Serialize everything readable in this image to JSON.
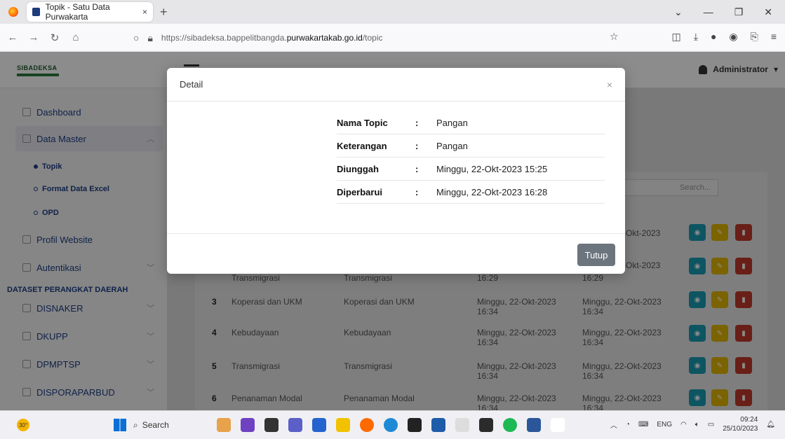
{
  "browser": {
    "tab_title": "Topik - Satu Data Purwakarta",
    "tab_close": "×",
    "new_tab": "+",
    "url_prefix": "https://sibadeksa.bappelitbangda.",
    "url_host": "purwakartakab.go.id",
    "url_path": "/topic"
  },
  "app": {
    "logo": "SIBADEKSA",
    "user": "Administrator"
  },
  "sidebar": {
    "dashboard": "Dashboard",
    "data_master": "Data Master",
    "topik": "Topik",
    "format_excel": "Format Data Excel",
    "opd": "OPD",
    "profil": "Profil Website",
    "autentikasi": "Autentikasi",
    "section": "DATASET PERANGKAT DAERAH",
    "disnaker": "DISNAKER",
    "dkupp": "DKUPP",
    "dpmptsp": "DPMPTSP",
    "disporaparbud": "DISPORAPARBUD"
  },
  "table": {
    "search_placeholder": "Search...",
    "partial": [
      "-Okt-2023",
      "-Okt-2023"
    ],
    "row2_c1": "Transmigrasi",
    "row2_c2": "Transmigrasi",
    "row2_c3": "16:29",
    "row2_c4": "16:29",
    "rows": [
      {
        "no": "3",
        "nama": "Koperasi dan UKM",
        "ket": "Koperasi dan UKM",
        "up": "Minggu, 22-Okt-2023 16:34",
        "upd": "Minggu, 22-Okt-2023 16:34"
      },
      {
        "no": "4",
        "nama": "Kebudayaan",
        "ket": "Kebudayaan",
        "up": "Minggu, 22-Okt-2023 16:34",
        "upd": "Minggu, 22-Okt-2023 16:34"
      },
      {
        "no": "5",
        "nama": "Transmigrasi",
        "ket": "Transmigrasi",
        "up": "Minggu, 22-Okt-2023 16:34",
        "upd": "Minggu, 22-Okt-2023 16:34"
      },
      {
        "no": "6",
        "nama": "Penanaman Modal",
        "ket": "Penanaman Modal",
        "up": "Minggu, 22-Okt-2023 16:34",
        "upd": "Minggu, 22-Okt-2023 16:34"
      }
    ]
  },
  "modal": {
    "title": "Detail",
    "close": "×",
    "fields": [
      {
        "k": "Nama Topic",
        "sep": ":",
        "v": "Pangan"
      },
      {
        "k": "Keterangan",
        "sep": ":",
        "v": "Pangan"
      },
      {
        "k": "Diunggah",
        "sep": ":",
        "v": "Minggu, 22-Okt-2023 15:25"
      },
      {
        "k": "Diperbarui",
        "sep": ":",
        "v": "Minggu, 22-Okt-2023 16:28"
      }
    ],
    "close_button": "Tutup"
  },
  "taskbar": {
    "temp": "30°",
    "search": "Search",
    "lang": "ENG",
    "time": "09:24",
    "date": "25/10/2023"
  }
}
